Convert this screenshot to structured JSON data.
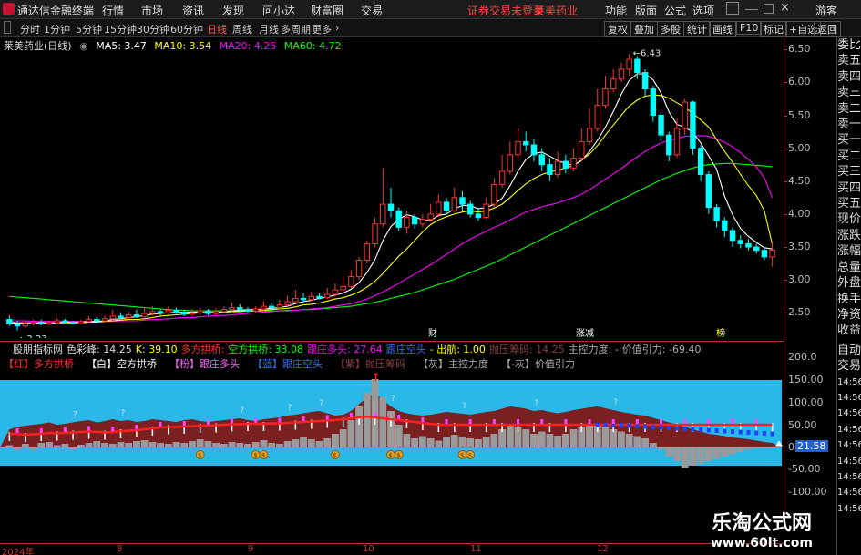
{
  "menubar": {
    "app_title": "通达信金融终端",
    "items": [
      "行情",
      "市场",
      "资讯",
      "发现",
      "问小达",
      "财富圈",
      "交易"
    ],
    "notice": "证券交易未登录",
    "stock_name": "莱美药业",
    "right_items": [
      "功能",
      "版面",
      "公式",
      "选项"
    ],
    "user": "游客"
  },
  "timeframes": {
    "items": [
      "分时",
      "1分钟",
      "5分钟",
      "15分钟",
      "30分钟",
      "60分钟",
      "日线",
      "周线",
      "月线",
      "多周期",
      "更多"
    ],
    "active": "日线",
    "more_icon": "chevron-right",
    "right_buttons": [
      "复权",
      "叠加",
      "多股",
      "统计",
      "画线",
      "F10",
      "标记",
      "+自选",
      "返回"
    ]
  },
  "chart_header": {
    "title": "莱美药业(日线)",
    "ma": [
      {
        "label": "MA5: 3.47",
        "color": "#ffffff"
      },
      {
        "label": "MA10: 3.54",
        "color": "#ffff00"
      },
      {
        "label": "MA20: 4.25",
        "color": "#ff00ff"
      },
      {
        "label": "MA60: 4.72",
        "color": "#00ff00"
      }
    ]
  },
  "price_axis": [
    "6.50",
    "6.00",
    "5.50",
    "5.00",
    "4.50",
    "4.00",
    "3.50",
    "3.00",
    "2.50"
  ],
  "chart_data": {
    "type": "candlestick",
    "high_label": "6.43",
    "low_label": "2.23",
    "ylim": [
      2.2,
      6.6
    ],
    "candles": [
      [
        2.4,
        2.33,
        2.46,
        2.3
      ],
      [
        2.33,
        2.3,
        2.38,
        2.23
      ],
      [
        2.3,
        2.34,
        2.37,
        2.28
      ],
      [
        2.34,
        2.36,
        2.4,
        2.31
      ],
      [
        2.36,
        2.33,
        2.4,
        2.31
      ],
      [
        2.33,
        2.35,
        2.38,
        2.31
      ],
      [
        2.35,
        2.38,
        2.42,
        2.33
      ],
      [
        2.38,
        2.36,
        2.41,
        2.34
      ],
      [
        2.36,
        2.34,
        2.38,
        2.32
      ],
      [
        2.34,
        2.37,
        2.4,
        2.32
      ],
      [
        2.37,
        2.4,
        2.45,
        2.35
      ],
      [
        2.4,
        2.38,
        2.44,
        2.36
      ],
      [
        2.38,
        2.41,
        2.46,
        2.36
      ],
      [
        2.41,
        2.45,
        2.55,
        2.38
      ],
      [
        2.45,
        2.43,
        2.5,
        2.4
      ],
      [
        2.43,
        2.47,
        2.52,
        2.41
      ],
      [
        2.47,
        2.44,
        2.55,
        2.42
      ],
      [
        2.44,
        2.49,
        2.58,
        2.42
      ],
      [
        2.49,
        2.52,
        2.6,
        2.46
      ],
      [
        2.52,
        2.5,
        2.56,
        2.46
      ],
      [
        2.5,
        2.54,
        2.6,
        2.48
      ],
      [
        2.54,
        2.51,
        2.58,
        2.48
      ],
      [
        2.51,
        2.48,
        2.55,
        2.45
      ],
      [
        2.48,
        2.5,
        2.56,
        2.45
      ],
      [
        2.5,
        2.53,
        2.58,
        2.47
      ],
      [
        2.53,
        2.49,
        2.56,
        2.46
      ],
      [
        2.49,
        2.52,
        2.57,
        2.46
      ],
      [
        2.52,
        2.55,
        2.6,
        2.49
      ],
      [
        2.55,
        2.58,
        2.66,
        2.52
      ],
      [
        2.58,
        2.55,
        2.63,
        2.52
      ],
      [
        2.55,
        2.53,
        2.59,
        2.5
      ],
      [
        2.53,
        2.56,
        2.6,
        2.5
      ],
      [
        2.56,
        2.6,
        2.68,
        2.53
      ],
      [
        2.6,
        2.58,
        2.66,
        2.55
      ],
      [
        2.58,
        2.62,
        2.7,
        2.56
      ],
      [
        2.62,
        2.67,
        2.76,
        2.6
      ],
      [
        2.67,
        2.72,
        2.85,
        2.64
      ],
      [
        2.72,
        2.7,
        2.8,
        2.66
      ],
      [
        2.7,
        2.75,
        2.82,
        2.68
      ],
      [
        2.75,
        2.73,
        2.8,
        2.7
      ],
      [
        2.73,
        2.78,
        2.88,
        2.71
      ],
      [
        2.78,
        2.85,
        2.95,
        2.75
      ],
      [
        2.85,
        2.9,
        3.05,
        2.82
      ],
      [
        2.9,
        3.05,
        3.15,
        2.88
      ],
      [
        3.05,
        3.3,
        3.35,
        3.0
      ],
      [
        3.3,
        3.55,
        3.6,
        3.25
      ],
      [
        3.55,
        3.85,
        3.95,
        3.5
      ],
      [
        3.85,
        4.15,
        4.7,
        3.8
      ],
      [
        4.15,
        4.05,
        4.4,
        3.95
      ],
      [
        4.05,
        3.8,
        4.1,
        3.75
      ],
      [
        3.8,
        3.95,
        4.05,
        3.7
      ],
      [
        3.95,
        3.85,
        4.0,
        3.78
      ],
      [
        3.85,
        3.92,
        4.0,
        3.8
      ],
      [
        3.92,
        4.0,
        4.15,
        3.88
      ],
      [
        4.0,
        4.18,
        4.3,
        3.95
      ],
      [
        4.18,
        4.05,
        4.25,
        4.0
      ],
      [
        4.05,
        4.25,
        4.4,
        4.02
      ],
      [
        4.25,
        4.15,
        4.35,
        4.05
      ],
      [
        4.15,
        4.0,
        4.2,
        3.95
      ],
      [
        4.0,
        3.95,
        4.1,
        3.9
      ],
      [
        3.95,
        4.15,
        4.25,
        3.92
      ],
      [
        4.15,
        4.45,
        4.55,
        4.1
      ],
      [
        4.45,
        4.65,
        4.9,
        4.4
      ],
      [
        4.65,
        4.9,
        5.1,
        4.6
      ],
      [
        4.9,
        5.1,
        5.3,
        4.85
      ],
      [
        5.1,
        5.05,
        5.25,
        4.95
      ],
      [
        5.05,
        4.9,
        5.15,
        4.8
      ],
      [
        4.9,
        4.75,
        5.0,
        4.65
      ],
      [
        4.75,
        4.6,
        4.85,
        4.5
      ],
      [
        4.6,
        4.8,
        4.95,
        4.55
      ],
      [
        4.8,
        4.7,
        4.9,
        4.62
      ],
      [
        4.7,
        4.85,
        5.0,
        4.65
      ],
      [
        4.85,
        5.1,
        5.3,
        4.8
      ],
      [
        5.1,
        5.3,
        5.6,
        5.05
      ],
      [
        5.3,
        5.65,
        5.9,
        5.25
      ],
      [
        5.65,
        5.9,
        6.1,
        5.6
      ],
      [
        5.9,
        6.05,
        6.2,
        5.85
      ],
      [
        6.05,
        6.2,
        6.3,
        6.0
      ],
      [
        6.2,
        6.35,
        6.43,
        6.1
      ],
      [
        6.35,
        6.15,
        6.4,
        6.05
      ],
      [
        6.15,
        5.9,
        6.2,
        5.8
      ],
      [
        5.9,
        5.5,
        5.95,
        5.4
      ],
      [
        5.5,
        5.2,
        5.55,
        5.1
      ],
      [
        5.2,
        4.9,
        5.25,
        4.8
      ],
      [
        4.9,
        5.3,
        5.45,
        4.85
      ],
      [
        5.3,
        5.7,
        5.75,
        5.2
      ],
      [
        5.7,
        5.0,
        5.72,
        4.9
      ],
      [
        5.0,
        4.6,
        5.05,
        4.5
      ],
      [
        4.6,
        4.1,
        4.65,
        4.0
      ],
      [
        4.1,
        3.9,
        4.15,
        3.8
      ],
      [
        3.9,
        3.75,
        3.95,
        3.65
      ],
      [
        3.75,
        3.6,
        3.8,
        3.5
      ],
      [
        3.6,
        3.55,
        3.68,
        3.48
      ],
      [
        3.55,
        3.5,
        3.62,
        3.45
      ],
      [
        3.5,
        3.45,
        3.55,
        3.4
      ],
      [
        3.45,
        3.35,
        3.5,
        3.3
      ],
      [
        3.35,
        3.45,
        3.58,
        3.2
      ]
    ],
    "ma5": [
      2.35,
      2.34,
      2.34,
      2.35,
      2.34,
      2.34,
      2.35,
      2.36,
      2.36,
      2.36,
      2.37,
      2.37,
      2.38,
      2.4,
      2.41,
      2.43,
      2.44,
      2.46,
      2.48,
      2.49,
      2.5,
      2.51,
      2.51,
      2.51,
      2.51,
      2.5,
      2.51,
      2.51,
      2.53,
      2.54,
      2.55,
      2.55,
      2.56,
      2.57,
      2.58,
      2.6,
      2.64,
      2.67,
      2.69,
      2.72,
      2.74,
      2.77,
      2.8,
      2.86,
      2.96,
      3.11,
      3.31,
      3.6,
      3.81,
      3.92,
      3.99,
      3.96,
      3.91,
      3.9,
      3.98,
      4.0,
      4.08,
      4.13,
      4.13,
      4.08,
      4.1,
      4.15,
      4.24,
      4.43,
      4.65,
      4.83,
      4.92,
      4.94,
      4.88,
      4.81,
      4.77,
      4.74,
      4.81,
      4.95,
      5.12,
      5.32,
      5.56,
      5.82,
      6.03,
      6.13,
      6.13,
      6.04,
      5.84,
      5.55,
      5.36,
      5.32,
      5.24,
      5.08,
      4.88,
      4.68,
      4.27,
      3.99,
      3.78,
      3.66,
      3.57,
      3.49,
      3.47
    ],
    "ma10": [
      2.36,
      2.35,
      2.35,
      2.35,
      2.35,
      2.35,
      2.35,
      2.35,
      2.35,
      2.35,
      2.36,
      2.36,
      2.37,
      2.38,
      2.39,
      2.4,
      2.4,
      2.41,
      2.43,
      2.45,
      2.46,
      2.47,
      2.48,
      2.49,
      2.5,
      2.5,
      2.51,
      2.51,
      2.52,
      2.52,
      2.53,
      2.53,
      2.54,
      2.55,
      2.56,
      2.57,
      2.59,
      2.62,
      2.63,
      2.65,
      2.68,
      2.71,
      2.73,
      2.77,
      2.82,
      2.89,
      2.98,
      3.1,
      3.23,
      3.36,
      3.47,
      3.6,
      3.73,
      3.84,
      3.91,
      3.96,
      4.0,
      4.03,
      4.05,
      4.03,
      4.05,
      4.09,
      4.15,
      4.25,
      4.36,
      4.46,
      4.54,
      4.6,
      4.64,
      4.67,
      4.7,
      4.74,
      4.82,
      4.91,
      5.04,
      5.2,
      5.35,
      5.5,
      5.64,
      5.73,
      5.79,
      5.81,
      5.8,
      5.76,
      5.69,
      5.62,
      5.53,
      5.43,
      5.32,
      5.13,
      4.95,
      4.79,
      4.6,
      4.43,
      4.28,
      4.05,
      3.54
    ],
    "ma20": [
      2.38,
      2.38,
      2.38,
      2.37,
      2.37,
      2.37,
      2.37,
      2.37,
      2.37,
      2.37,
      2.37,
      2.37,
      2.37,
      2.37,
      2.38,
      2.38,
      2.38,
      2.39,
      2.4,
      2.4,
      2.41,
      2.42,
      2.43,
      2.43,
      2.44,
      2.45,
      2.46,
      2.46,
      2.47,
      2.48,
      2.49,
      2.5,
      2.51,
      2.52,
      2.53,
      2.53,
      2.54,
      2.55,
      2.56,
      2.57,
      2.58,
      2.6,
      2.62,
      2.64,
      2.67,
      2.71,
      2.76,
      2.82,
      2.88,
      2.95,
      3.02,
      3.09,
      3.16,
      3.23,
      3.31,
      3.39,
      3.47,
      3.55,
      3.62,
      3.68,
      3.74,
      3.8,
      3.85,
      3.91,
      3.97,
      4.03,
      4.07,
      4.11,
      4.14,
      4.17,
      4.21,
      4.25,
      4.3,
      4.37,
      4.45,
      4.53,
      4.61,
      4.69,
      4.78,
      4.87,
      4.95,
      5.02,
      5.08,
      5.12,
      5.15,
      5.18,
      5.19,
      5.19,
      5.18,
      5.14,
      5.09,
      5.02,
      4.93,
      4.83,
      4.72,
      4.55,
      4.25
    ],
    "ma60": [
      2.75,
      2.74,
      2.73,
      2.72,
      2.71,
      2.7,
      2.69,
      2.68,
      2.67,
      2.66,
      2.65,
      2.64,
      2.63,
      2.62,
      2.61,
      2.6,
      2.59,
      2.58,
      2.57,
      2.56,
      2.55,
      2.54,
      2.54,
      2.53,
      2.53,
      2.53,
      2.53,
      2.53,
      2.53,
      2.53,
      2.53,
      2.53,
      2.53,
      2.53,
      2.53,
      2.54,
      2.54,
      2.55,
      2.55,
      2.56,
      2.57,
      2.58,
      2.59,
      2.6,
      2.62,
      2.64,
      2.66,
      2.69,
      2.72,
      2.75,
      2.78,
      2.81,
      2.85,
      2.89,
      2.93,
      2.97,
      3.01,
      3.06,
      3.11,
      3.16,
      3.21,
      3.26,
      3.32,
      3.38,
      3.44,
      3.5,
      3.56,
      3.62,
      3.68,
      3.74,
      3.8,
      3.86,
      3.92,
      3.98,
      4.04,
      4.1,
      4.16,
      4.22,
      4.28,
      4.34,
      4.4,
      4.46,
      4.52,
      4.57,
      4.62,
      4.66,
      4.7,
      4.73,
      4.75,
      4.76,
      4.77,
      4.77,
      4.76,
      4.75,
      4.74,
      4.73,
      4.72
    ]
  },
  "event_markers": [
    {
      "label": "财",
      "color": "#ffffff"
    },
    {
      "label": "涨减",
      "color": "#ffffff"
    },
    {
      "label": "榜",
      "color": "#ffff00"
    }
  ],
  "indicator": {
    "header": [
      {
        "text": "股朋指标网",
        "color": "#dddddd"
      },
      {
        "text": "色彩峰: 14.25",
        "color": "#dddddd"
      },
      {
        "text": "K: 39.10",
        "color": "#ffff00"
      },
      {
        "text": "多方拱桥:",
        "color": "#ff3030"
      },
      {
        "text": "空方拱桥: 33.08",
        "color": "#00ff00"
      },
      {
        "text": "跟庄多头: 27.64",
        "color": "#ff00ff"
      },
      {
        "text": "跟庄空头",
        "color": "#3070ff"
      },
      {
        "text": "- 出航: 1.00",
        "color": "#ffff00"
      },
      {
        "text": "抛压筹码: 14.25",
        "color": "#884040"
      },
      {
        "text": "主控力度: -",
        "color": "#aaaaaa"
      },
      {
        "text": "价值引力: -69.40",
        "color": "#aaaaaa"
      }
    ],
    "legend": [
      {
        "text": "【红】多方拱桥",
        "color": "#ff3030"
      },
      {
        "text": "【白】空方拱桥",
        "color": "#ffffff"
      },
      {
        "text": "【粉】跟庄多头",
        "color": "#ff60ff"
      },
      {
        "text": "【蓝】跟庄空头",
        "color": "#3070ff"
      },
      {
        "text": "【紫】抛压筹码",
        "color": "#884040"
      },
      {
        "text": "【灰】主控力度",
        "color": "#aaaaaa"
      },
      {
        "text": "【-灰】价值引力",
        "color": "#aaaaaa"
      }
    ],
    "axis": [
      "200.0",
      "150.00",
      "100.00",
      "50.00",
      "0.00",
      "-50.00",
      "-100.00"
    ],
    "current_value": "21.58",
    "gray_bars": [
      5,
      -5,
      8,
      -6,
      10,
      12,
      5,
      8,
      -4,
      6,
      10,
      14,
      10,
      8,
      12,
      10,
      14,
      16,
      12,
      10,
      8,
      12,
      10,
      14,
      18,
      14,
      10,
      8,
      12,
      10,
      8,
      12,
      16,
      10,
      8,
      14,
      18,
      22,
      18,
      14,
      20,
      30,
      40,
      60,
      90,
      120,
      150,
      110,
      80,
      50,
      30,
      20,
      25,
      20,
      15,
      22,
      28,
      24,
      20,
      18,
      22,
      30,
      40,
      50,
      45,
      40,
      30,
      35,
      30,
      26,
      30,
      40,
      45,
      48,
      50,
      44,
      40,
      35,
      30,
      25,
      20,
      10,
      -5,
      -20,
      -30,
      -45,
      -40,
      -35,
      -30,
      -25,
      -20,
      -15,
      -10,
      -5,
      -2,
      -1,
      -1
    ],
    "brown_top": [
      40,
      45,
      48,
      50,
      52,
      55,
      50,
      52,
      55,
      58,
      60,
      55,
      58,
      62,
      58,
      60,
      56,
      58,
      62,
      60,
      58,
      56,
      60,
      62,
      58,
      56,
      58,
      60,
      62,
      64,
      60,
      58,
      62,
      64,
      66,
      70,
      72,
      75,
      78,
      80,
      75,
      70,
      72,
      80,
      95,
      110,
      120,
      105,
      90,
      80,
      75,
      72,
      70,
      72,
      75,
      78,
      76,
      74,
      72,
      75,
      78,
      80,
      85,
      90,
      88,
      85,
      80,
      82,
      78,
      75,
      78,
      82,
      85,
      88,
      90,
      86,
      82,
      78,
      75,
      72,
      70,
      65,
      60,
      55,
      50,
      45,
      40,
      35,
      30,
      28,
      25,
      22,
      20,
      18,
      15,
      12,
      10
    ],
    "red_line": [
      30,
      30,
      28,
      29,
      30,
      32,
      31,
      32,
      33,
      34,
      35,
      34,
      33,
      34,
      36,
      37,
      38,
      40,
      42,
      44,
      45,
      45,
      46,
      47,
      48,
      48,
      49,
      50,
      51,
      51,
      52,
      52,
      52,
      53,
      53,
      54,
      55,
      56,
      57,
      58,
      59,
      60,
      62,
      64,
      66,
      68,
      66,
      64,
      62,
      60,
      58,
      56,
      54,
      52,
      50,
      50,
      50,
      50,
      50,
      50,
      50,
      50,
      50,
      50,
      50,
      50,
      50,
      50,
      50,
      50,
      50,
      50,
      50,
      50,
      50,
      50,
      50,
      50,
      50,
      50,
      50,
      50,
      50,
      50,
      50,
      50,
      50,
      50,
      50,
      50,
      50,
      50,
      50,
      50,
      50,
      50,
      50
    ],
    "blue_line": [
      0,
      0,
      0,
      0,
      0,
      0,
      0,
      0,
      0,
      0,
      0,
      0,
      0,
      0,
      0,
      0,
      0,
      0,
      0,
      0,
      0,
      0,
      0,
      0,
      0,
      0,
      0,
      0,
      0,
      0,
      0,
      0,
      0,
      0,
      0,
      0,
      0,
      0,
      0,
      0,
      0,
      0,
      0,
      0,
      0,
      0,
      0,
      0,
      0,
      0,
      0,
      0,
      0,
      0,
      0,
      0,
      0,
      0,
      0,
      0,
      0,
      0,
      0,
      0,
      0,
      0,
      0,
      0,
      0,
      0,
      0,
      0,
      0,
      0,
      50,
      50,
      50,
      50,
      49,
      48,
      47,
      46,
      45,
      44,
      43,
      42,
      41,
      40,
      39,
      38,
      37,
      36,
      35,
      34,
      33,
      32,
      31
    ],
    "money_positions": [
      24,
      31,
      32,
      41,
      48,
      49,
      57,
      58
    ],
    "question_positions": [
      8,
      14,
      29,
      35,
      39,
      48,
      57,
      66,
      76
    ]
  },
  "date_axis": [
    "2024年",
    "8",
    "9",
    "10",
    "11",
    "12"
  ],
  "side_panel": [
    "委比",
    "卖五",
    "卖四",
    "卖三",
    "卖二",
    "卖一",
    "买一",
    "买二",
    "买三",
    "买四",
    "买五",
    "现价",
    "涨跌",
    "涨幅",
    "总量",
    "外盘",
    "换手",
    "净资",
    "收益",
    "自动",
    "交易",
    "14:56",
    "14:56",
    "14:56",
    "14:56",
    "14:56",
    "14:56",
    "14:56",
    "14:56",
    "14:56"
  ],
  "watermark": {
    "title": "乐淘公式网",
    "url": "www.60lt.com"
  },
  "colors": {
    "up": "#ff3232",
    "down": "#00ffff",
    "ma5": "#ffffff",
    "ma10": "#ffff00",
    "ma20": "#ff00ff",
    "ma60": "#00ff00",
    "cyan_fill": "#29b8e8",
    "brown": "#7a2020",
    "gray_bar": "#9a9a9a"
  }
}
